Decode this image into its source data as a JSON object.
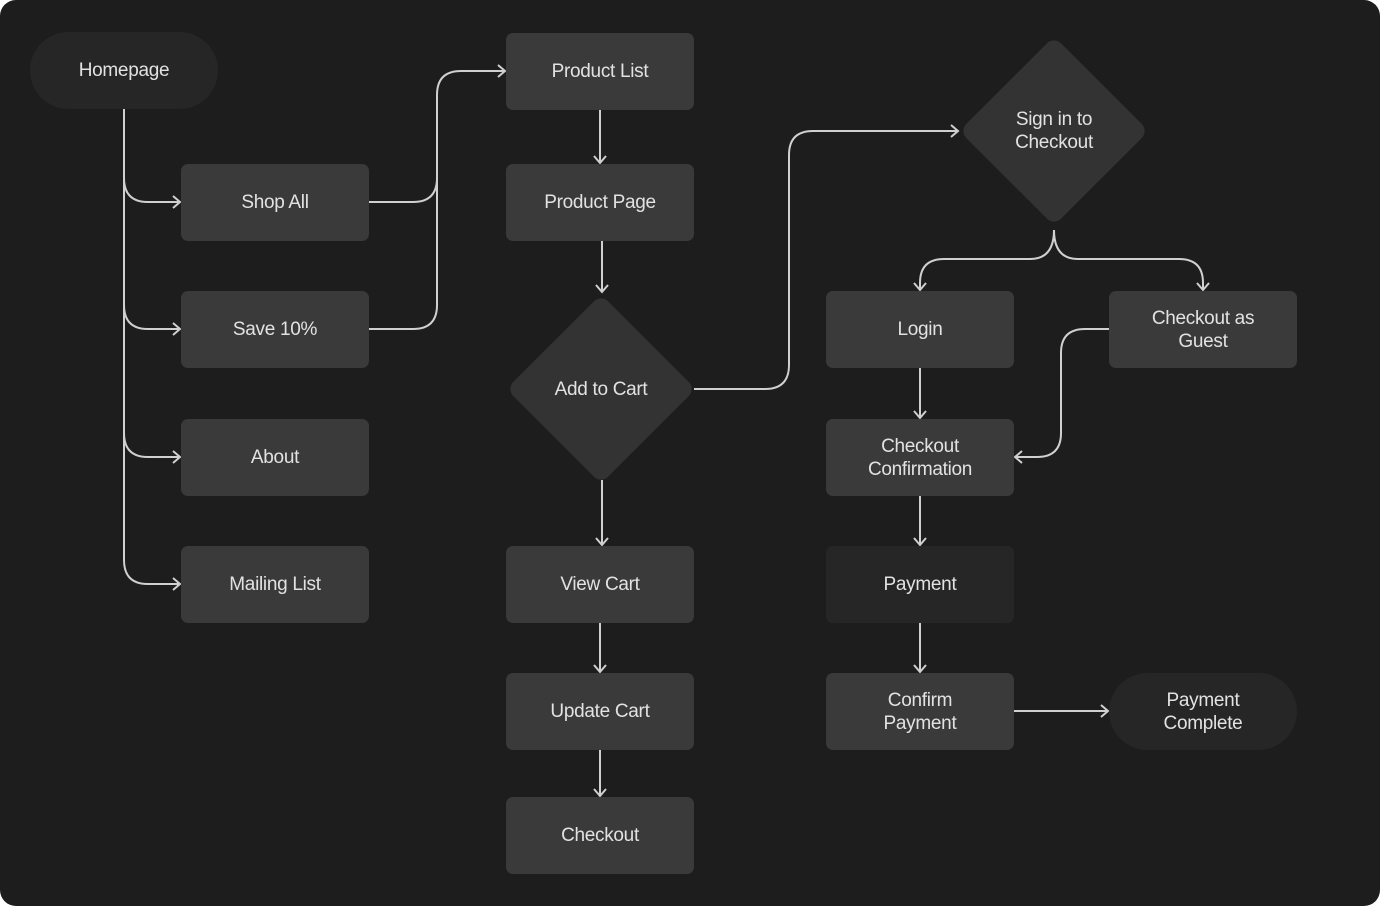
{
  "colors": {
    "background": "#1d1d1d",
    "box": "#3a3a3a",
    "terminal": "#262626",
    "decision": "#333333",
    "connector": "#d0d0d0",
    "text": "#e2e2e2"
  },
  "nodes": {
    "homepage": "Homepage",
    "shop_all": "Shop All",
    "save_10": "Save 10%",
    "about": "About",
    "mailing_list": "Mailing List",
    "product_list": "Product List",
    "product_page": "Product Page",
    "add_to_cart": "Add to Cart",
    "view_cart": "View Cart",
    "update_cart": "Update Cart",
    "checkout": "Checkout",
    "sign_in_to_checkout": "Sign in to Checkout",
    "login": "Login",
    "checkout_as_guest": "Checkout as Guest",
    "checkout_confirmation": "Checkout Confirmation",
    "payment": "Payment",
    "confirm_payment": "Confirm Payment",
    "payment_complete": "Payment Complete"
  }
}
